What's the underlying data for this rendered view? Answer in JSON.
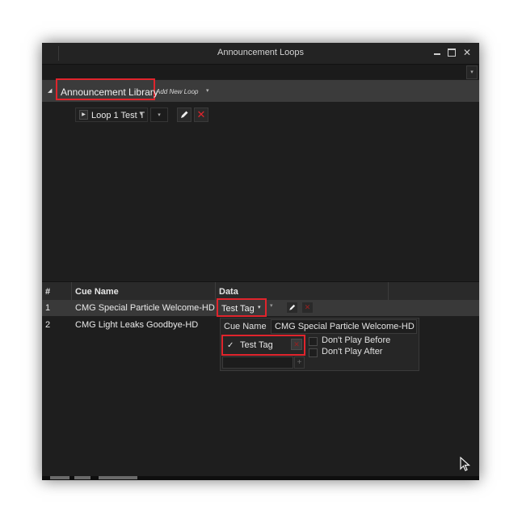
{
  "window": {
    "title": "Announcement Loops",
    "controls": {
      "minimize_icon": "minimize-icon",
      "maximize_icon": "maximize-icon",
      "close_icon": "close-icon",
      "close_glyph": "✕"
    },
    "toolbar_dropdown_glyph": "▾"
  },
  "library": {
    "expand_glyph": "◢",
    "label": "Announcement Library",
    "add_new_loop": "Add New Loop",
    "add_caret": "▾"
  },
  "loop": {
    "play_glyph": "▶",
    "label": "Loop 1 Test T",
    "caret": "▾",
    "dropdown_glyph": "▾",
    "delete_glyph": "✕"
  },
  "grid": {
    "columns": [
      "#",
      "Cue Name",
      "Data"
    ],
    "rows": [
      {
        "num": "1",
        "cue": "CMG Special Particle Welcome-HD"
      },
      {
        "num": "2",
        "cue": "CMG Light Leaks Goodbye-HD"
      }
    ]
  },
  "row1_tag": {
    "label": "Test Tag",
    "caret": "▾",
    "dropdown_glyph": "▾",
    "delete_glyph": "✕"
  },
  "popup": {
    "cue_name_label": "Cue Name",
    "cue_name_value": "CMG Special Particle Welcome-HD",
    "tag_check_glyph": "✓",
    "tag_label": "Test Tag",
    "tag_delete_glyph": "✕",
    "dont_play_before": "Don't Play Before",
    "dont_play_after": "Don't Play After",
    "add_glyph": "+"
  },
  "colors": {
    "accent_red": "#e0242c",
    "window_bg": "#1e1e1e",
    "header_bg": "#3b3b3b"
  }
}
